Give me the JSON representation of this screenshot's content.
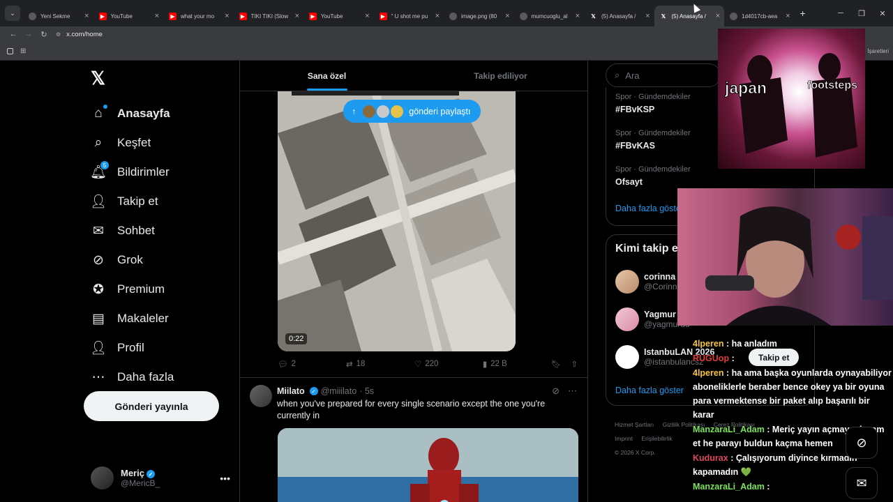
{
  "browser": {
    "tabs": [
      {
        "title": "Yeni Sekme",
        "icon": "globe-icon"
      },
      {
        "title": "YouTube",
        "icon": "youtube-icon"
      },
      {
        "title": "what your mo",
        "icon": "youtube-icon"
      },
      {
        "title": "TIKI TIKI (Slow",
        "icon": "youtube-icon"
      },
      {
        "title": "YouTube",
        "icon": "youtube-icon"
      },
      {
        "title": "\" U shot me pu",
        "icon": "youtube-icon"
      },
      {
        "title": "image.png (80",
        "icon": "globe-icon"
      },
      {
        "title": "mumcuoglu_al",
        "icon": "globe-icon"
      },
      {
        "title": "(5) Anasayfa / ",
        "icon": "x-icon"
      },
      {
        "title": "(5) Anasayfa / ",
        "icon": "x-icon",
        "active": true
      },
      {
        "title": "1d4017cb-aea",
        "icon": "globe-icon"
      }
    ],
    "url": "x.com/home",
    "bookmarks_right": "İşaretleri"
  },
  "sidebar": {
    "items": [
      {
        "label": "Anasayfa",
        "icon": "home-icon"
      },
      {
        "label": "Keşfet",
        "icon": "search-icon"
      },
      {
        "label": "Bildirimler",
        "icon": "bell-icon",
        "badge": "5"
      },
      {
        "label": "Takip et",
        "icon": "person-add-icon"
      },
      {
        "label": "Sohbet",
        "icon": "mail-icon"
      },
      {
        "label": "Grok",
        "icon": "grok-icon"
      },
      {
        "label": "Premium",
        "icon": "verified-badge-icon"
      },
      {
        "label": "Makaleler",
        "icon": "article-icon"
      },
      {
        "label": "Profil",
        "icon": "profile-icon"
      },
      {
        "label": "Daha fazla",
        "icon": "more-circle-icon"
      }
    ],
    "post_button": "Gönderi yayınla",
    "profile": {
      "name": "Meriç",
      "handle": "@MericB_"
    }
  },
  "feed": {
    "tabs": [
      "Sana özel",
      "Takip ediliyor"
    ],
    "pill": "gönderi paylaştı",
    "video_time": "0:22",
    "stats": {
      "replies": "2",
      "reposts": "18",
      "likes": "220",
      "views": "22 B"
    },
    "tweet2": {
      "name": "Miilato",
      "handle": "@miiilato",
      "time": "· 5s",
      "text": "when you've prepared for every single scenario except the one you're currently in"
    }
  },
  "right": {
    "search_placeholder": "Ara",
    "trends": [
      {
        "category": "Spor · Gündemdekiler",
        "name": "#FBvKSP"
      },
      {
        "category": "Spor · Gündemdekiler",
        "name": "#FBvKAS"
      },
      {
        "category": "Spor · Gündemdekiler",
        "name": "Ofsayt"
      }
    ],
    "trends_more": "Daha fazla göster",
    "follow_title": "Kimi takip e",
    "follow_users": [
      {
        "name": "corinna",
        "handle": "@Corinn"
      },
      {
        "name": "Yagmur",
        "handle": "@yagmurdd"
      },
      {
        "name": "IstanbuLAN 2026",
        "handle": "@istanbulancs2"
      }
    ],
    "follow_more": "Daha fazla göster",
    "footer": [
      "Hizmet Şartları",
      "Gizlilik Politikası",
      "Çerez Politikası",
      "Imprint",
      "Erişilebilirlik",
      "© 2026 X Corp."
    ]
  },
  "overlay": {
    "image_word1": "japan",
    "image_word2": "footsteps",
    "follow_chip": "Takip et",
    "chat": [
      {
        "user": "4lperen",
        "text": ": ha anladım",
        "color": "#f5c542"
      },
      {
        "user": "RUGUop",
        "text": ":",
        "color": "#e03c3c"
      },
      {
        "user": "4lperen",
        "text": ": ha ama başka oyunlarda oynayabiliyor aboneliklerle beraber bence okey ya bir oyuna para vermektense bir paket alıp başarılı bir karar",
        "color": "#f5c542"
      },
      {
        "user": "ManzaraLi_Adam",
        "text": ": Meriç yayın açmaya devam et he parayı buldun kaçma hemen",
        "color": "#7ce35a"
      },
      {
        "user": "Kudurax",
        "text": ": Çalışıyorum diyince kırmadın kapamadın 💚",
        "color": "#e0485a"
      },
      {
        "user": "ManzaraLi_Adam",
        "text": ":",
        "color": "#7ce35a"
      }
    ]
  }
}
